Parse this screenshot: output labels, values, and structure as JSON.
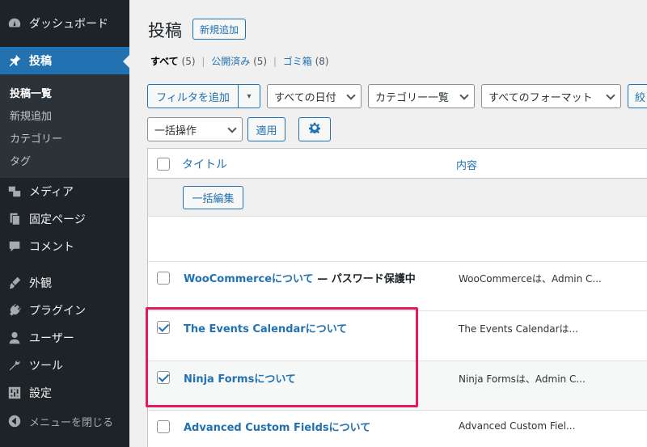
{
  "sidebar": {
    "items": [
      {
        "label": "ダッシュボード",
        "icon": "dashboard-icon"
      },
      {
        "label": "投稿",
        "icon": "pin-icon"
      },
      {
        "label": "メディア",
        "icon": "media-icon"
      },
      {
        "label": "固定ページ",
        "icon": "page-icon"
      },
      {
        "label": "コメント",
        "icon": "comment-icon"
      },
      {
        "label": "外観",
        "icon": "brush-icon"
      },
      {
        "label": "プラグイン",
        "icon": "plugin-icon"
      },
      {
        "label": "ユーザー",
        "icon": "user-icon"
      },
      {
        "label": "ツール",
        "icon": "wrench-icon"
      },
      {
        "label": "設定",
        "icon": "settings-icon"
      },
      {
        "label": "メニューを閉じる",
        "icon": "collapse-icon"
      }
    ],
    "submenu": [
      "投稿一覧",
      "新規追加",
      "カテゴリー",
      "タグ"
    ],
    "accent": "#2271b1"
  },
  "header": {
    "title": "投稿",
    "add_new": "新規追加"
  },
  "views": {
    "all": {
      "label": "すべて",
      "count": "(5)"
    },
    "published": {
      "label": "公開済み",
      "count": "(5)"
    },
    "trash": {
      "label": "ゴミ箱",
      "count": "(8)"
    },
    "separator": "|"
  },
  "filters": {
    "add_filter": "フィルタを追加",
    "dropdown_arrow": "▾",
    "dates": "すべての日付",
    "categories": "カテゴリー一覧",
    "formats": "すべてのフォーマット",
    "narrow": "絞"
  },
  "bulk": {
    "action": "一括操作",
    "apply": "適用",
    "settings_icon": "gear-icon"
  },
  "table": {
    "col_title": "タイトル",
    "col_content": "内容",
    "bulk_edit": "一括編集",
    "rows": [
      {
        "title": "WooCommerceについて",
        "state": " — パスワード保護中",
        "excerpt": "WooCommerceは、Admin C...",
        "checked": false
      },
      {
        "title": "The Events Calendarについて",
        "state": "",
        "excerpt": "The Events Calendarは...",
        "checked": true
      },
      {
        "title": "Ninja Formsについて",
        "state": "",
        "excerpt": "Ninja Formsは、Admin C...",
        "checked": true
      },
      {
        "title": "Advanced Custom Fieldsについて",
        "state": "",
        "excerpt": "Advanced Custom Fiel...",
        "checked": false
      }
    ]
  },
  "highlight_color": "#e6195a"
}
